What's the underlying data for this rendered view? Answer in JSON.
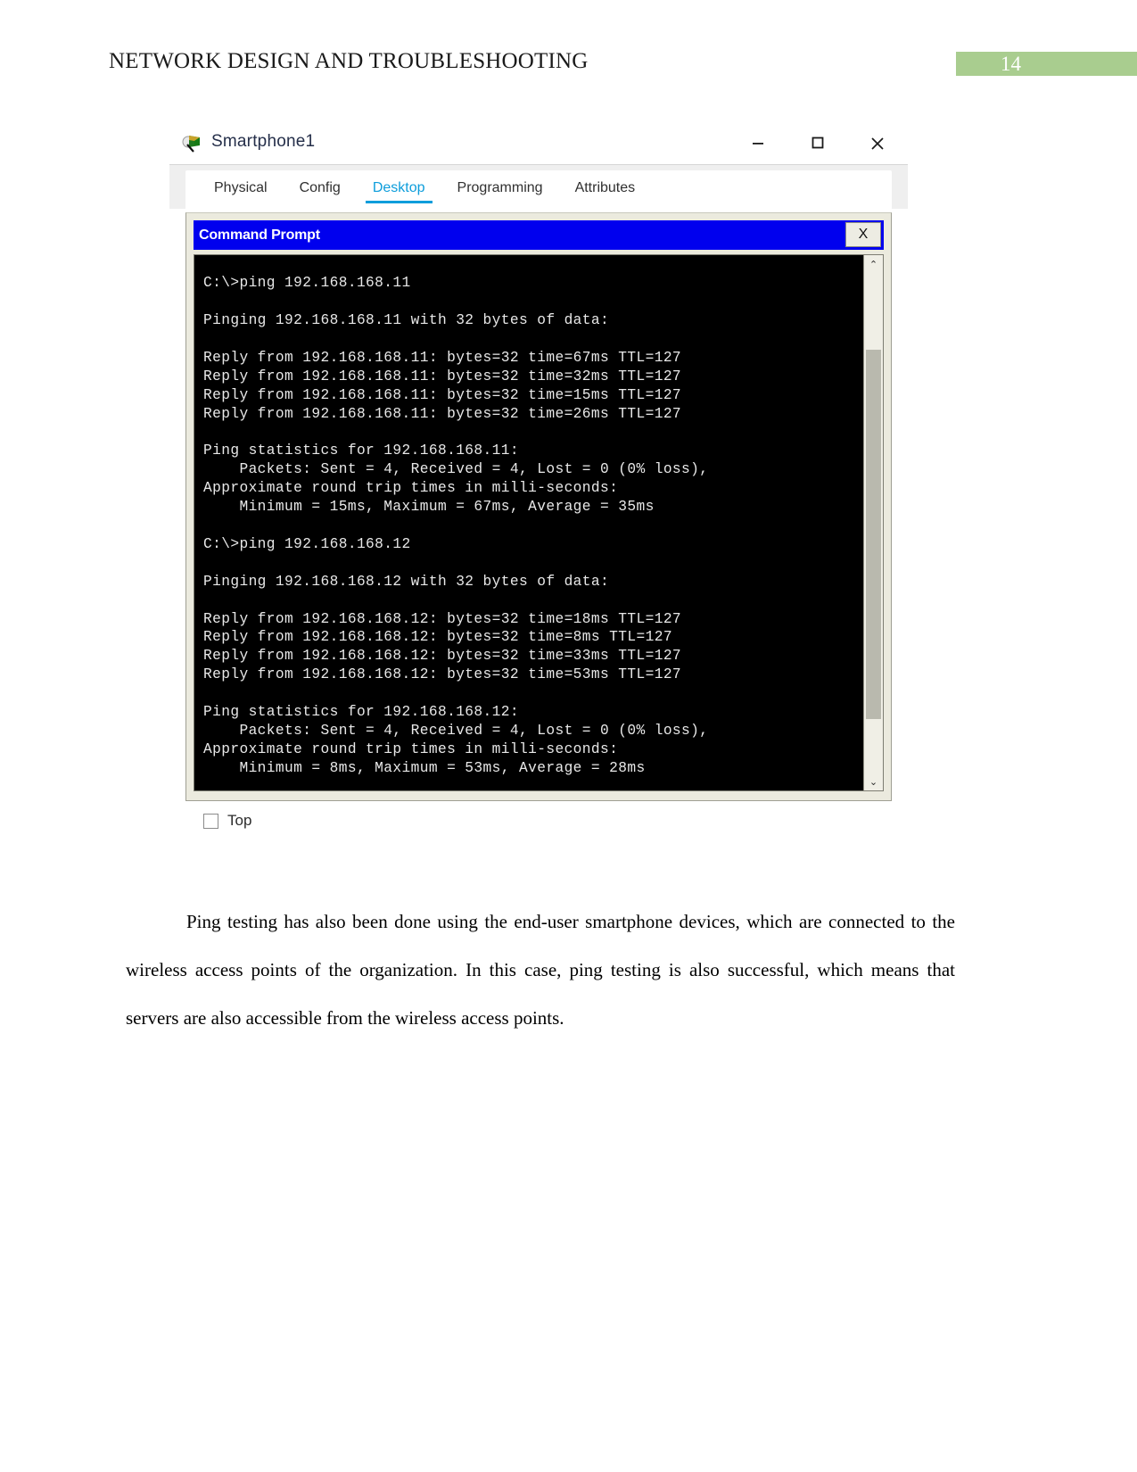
{
  "header": {
    "doc_title": "NETWORK DESIGN AND TROUBLESHOOTING",
    "page_number": "14",
    "badge_color": "#a9cd8f"
  },
  "app_window": {
    "title": "Smartphone1",
    "icon": "packet-tracer-icon",
    "controls": {
      "minimize": "minimize-icon",
      "maximize": "maximize-icon",
      "close": "close-icon"
    },
    "tabs": [
      {
        "label": "Physical",
        "active": false
      },
      {
        "label": "Config",
        "active": false
      },
      {
        "label": "Desktop",
        "active": true
      },
      {
        "label": "Programming",
        "active": false
      },
      {
        "label": "Attributes",
        "active": false
      }
    ],
    "active_tab_color": "#0d9ddb",
    "command_prompt": {
      "title": "Command Prompt",
      "titlebar_color": "#0000ee",
      "close_label": "X",
      "scrollbar": {
        "up_arrow": "⌃",
        "down_arrow": "⌄"
      },
      "terminal_text": "C:\\>ping 192.168.168.11\n\nPinging 192.168.168.11 with 32 bytes of data:\n\nReply from 192.168.168.11: bytes=32 time=67ms TTL=127\nReply from 192.168.168.11: bytes=32 time=32ms TTL=127\nReply from 192.168.168.11: bytes=32 time=15ms TTL=127\nReply from 192.168.168.11: bytes=32 time=26ms TTL=127\n\nPing statistics for 192.168.168.11:\n    Packets: Sent = 4, Received = 4, Lost = 0 (0% loss),\nApproximate round trip times in milli-seconds:\n    Minimum = 15ms, Maximum = 67ms, Average = 35ms\n\nC:\\>ping 192.168.168.12\n\nPinging 192.168.168.12 with 32 bytes of data:\n\nReply from 192.168.168.12: bytes=32 time=18ms TTL=127\nReply from 192.168.168.12: bytes=32 time=8ms TTL=127\nReply from 192.168.168.12: bytes=32 time=33ms TTL=127\nReply from 192.168.168.12: bytes=32 time=53ms TTL=127\n\nPing statistics for 192.168.168.12:\n    Packets: Sent = 4, Received = 4, Lost = 0 (0% loss),\nApproximate round trip times in milli-seconds:\n    Minimum = 8ms, Maximum = 53ms, Average = 28ms"
    },
    "bottom": {
      "checkbox_label": "Top",
      "checkbox_checked": false
    }
  },
  "content": {
    "paragraph": "Ping testing has also been done using the end-user smartphone devices, which are connected to the wireless access points of the organization. In this case, ping testing is also successful, which means that servers are also accessible from the wireless access points."
  }
}
